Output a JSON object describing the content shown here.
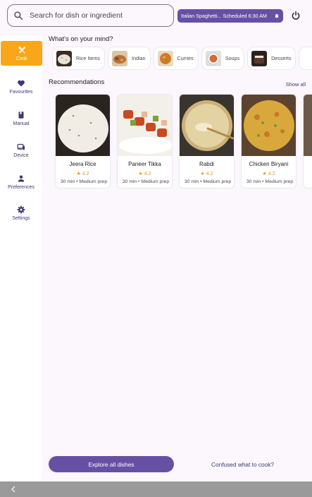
{
  "search": {
    "placeholder": "Search for dish or ingredient"
  },
  "schedule": {
    "text": "Italian Spaghetti... Scheduled 6:30 AM"
  },
  "sidebar": {
    "items": [
      {
        "label": "Cook",
        "icon": "fork-knife-icon",
        "active": true
      },
      {
        "label": "Favourites",
        "icon": "heart-icon"
      },
      {
        "label": "Manual",
        "icon": "book-icon"
      },
      {
        "label": "Device",
        "icon": "device-icon"
      },
      {
        "label": "Preferences",
        "icon": "person-icon"
      },
      {
        "label": "Settings",
        "icon": "gear-icon"
      }
    ]
  },
  "main": {
    "mind_title": "What's on your mind?",
    "categories": [
      {
        "label": "Rice Items",
        "color": "#c9c2b8"
      },
      {
        "label": "Indian",
        "color": "#b5703a"
      },
      {
        "label": "Curries",
        "color": "#d07a2a"
      },
      {
        "label": "Soups",
        "color": "#cf6a3a"
      },
      {
        "label": "Desserts",
        "color": "#5a3a2a"
      }
    ],
    "recs_title": "Recommendations",
    "show_all": "Show all",
    "recommendations": [
      {
        "name": "Jeera Rice",
        "rating": "★ 4.2",
        "meta": "30 min • Medium prep"
      },
      {
        "name": "Paneer Tikka",
        "rating": "★ 4.2",
        "meta": "30 min • Medium prep"
      },
      {
        "name": "Rabdi",
        "rating": "★ 4.2",
        "meta": "30 min • Medium prep"
      },
      {
        "name": "Chicken Biryani",
        "rating": "★ 4.2",
        "meta": "30 min • Medium prep"
      }
    ],
    "explore_label": "Explore all dishes",
    "confused_label": "Confused what to cook?"
  },
  "colors": {
    "accent": "#6750a4",
    "nav_active": "#f9a61a",
    "rating": "#e29a1d"
  }
}
